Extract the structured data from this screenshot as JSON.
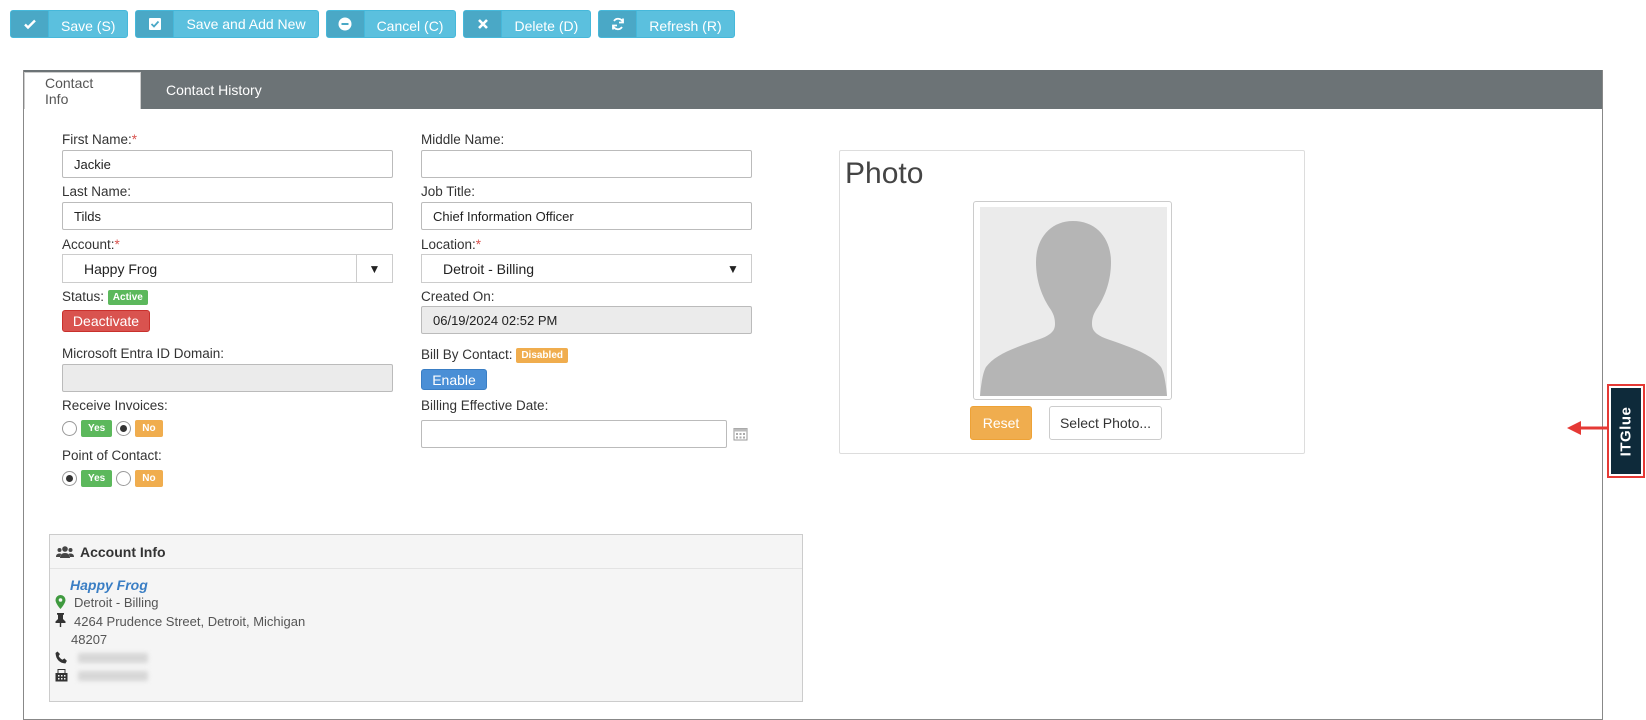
{
  "toolbar": {
    "save": "Save (S)",
    "save_add": "Save and Add New",
    "cancel": "Cancel (C)",
    "delete": "Delete (D)",
    "refresh": "Refresh (R)"
  },
  "tabs": {
    "contact_info": "Contact Info",
    "contact_history": "Contact History"
  },
  "form": {
    "first_name_label": "First Name:",
    "first_name": "Jackie",
    "middle_name_label": "Middle Name:",
    "middle_name": "",
    "last_name_label": "Last Name:",
    "last_name": "Tilds",
    "job_title_label": "Job Title:",
    "job_title": "Chief Information Officer",
    "account_label": "Account:",
    "account": "Happy Frog",
    "location_label": "Location:",
    "location": "Detroit - Billing",
    "status_label": "Status:",
    "status_badge": "Active",
    "deactivate": "Deactivate",
    "created_on_label": "Created On:",
    "created_on": "06/19/2024 02:52 PM",
    "entra_label": "Microsoft Entra ID Domain:",
    "entra_value": "",
    "bill_by_contact_label": "Bill By Contact:",
    "bill_by_contact_badge": "Disabled",
    "enable": "Enable",
    "receive_invoices_label": "Receive Invoices:",
    "billing_effective_label": "Billing Effective Date:",
    "billing_effective": "",
    "point_of_contact_label": "Point of Contact:",
    "yes": "Yes",
    "no": "No",
    "required_mark": "*"
  },
  "account_info": {
    "title": "Account Info",
    "name": "Happy Frog",
    "location": "Detroit - Billing",
    "address_line1": "4264 Prudence Street, Detroit, Michigan",
    "address_line2": "48207"
  },
  "photo": {
    "title": "Photo",
    "reset": "Reset",
    "select": "Select Photo..."
  },
  "sidebar": {
    "itglue": "ITGlue"
  },
  "colors": {
    "toolbar_button": "#5bc0de",
    "tab_bar": "#6c7376",
    "required": "#d9534f",
    "active_badge": "#5cb85c",
    "disabled_badge": "#f0ad4e",
    "itglue_bg": "#0e2a3a",
    "highlight": "#e53935"
  }
}
